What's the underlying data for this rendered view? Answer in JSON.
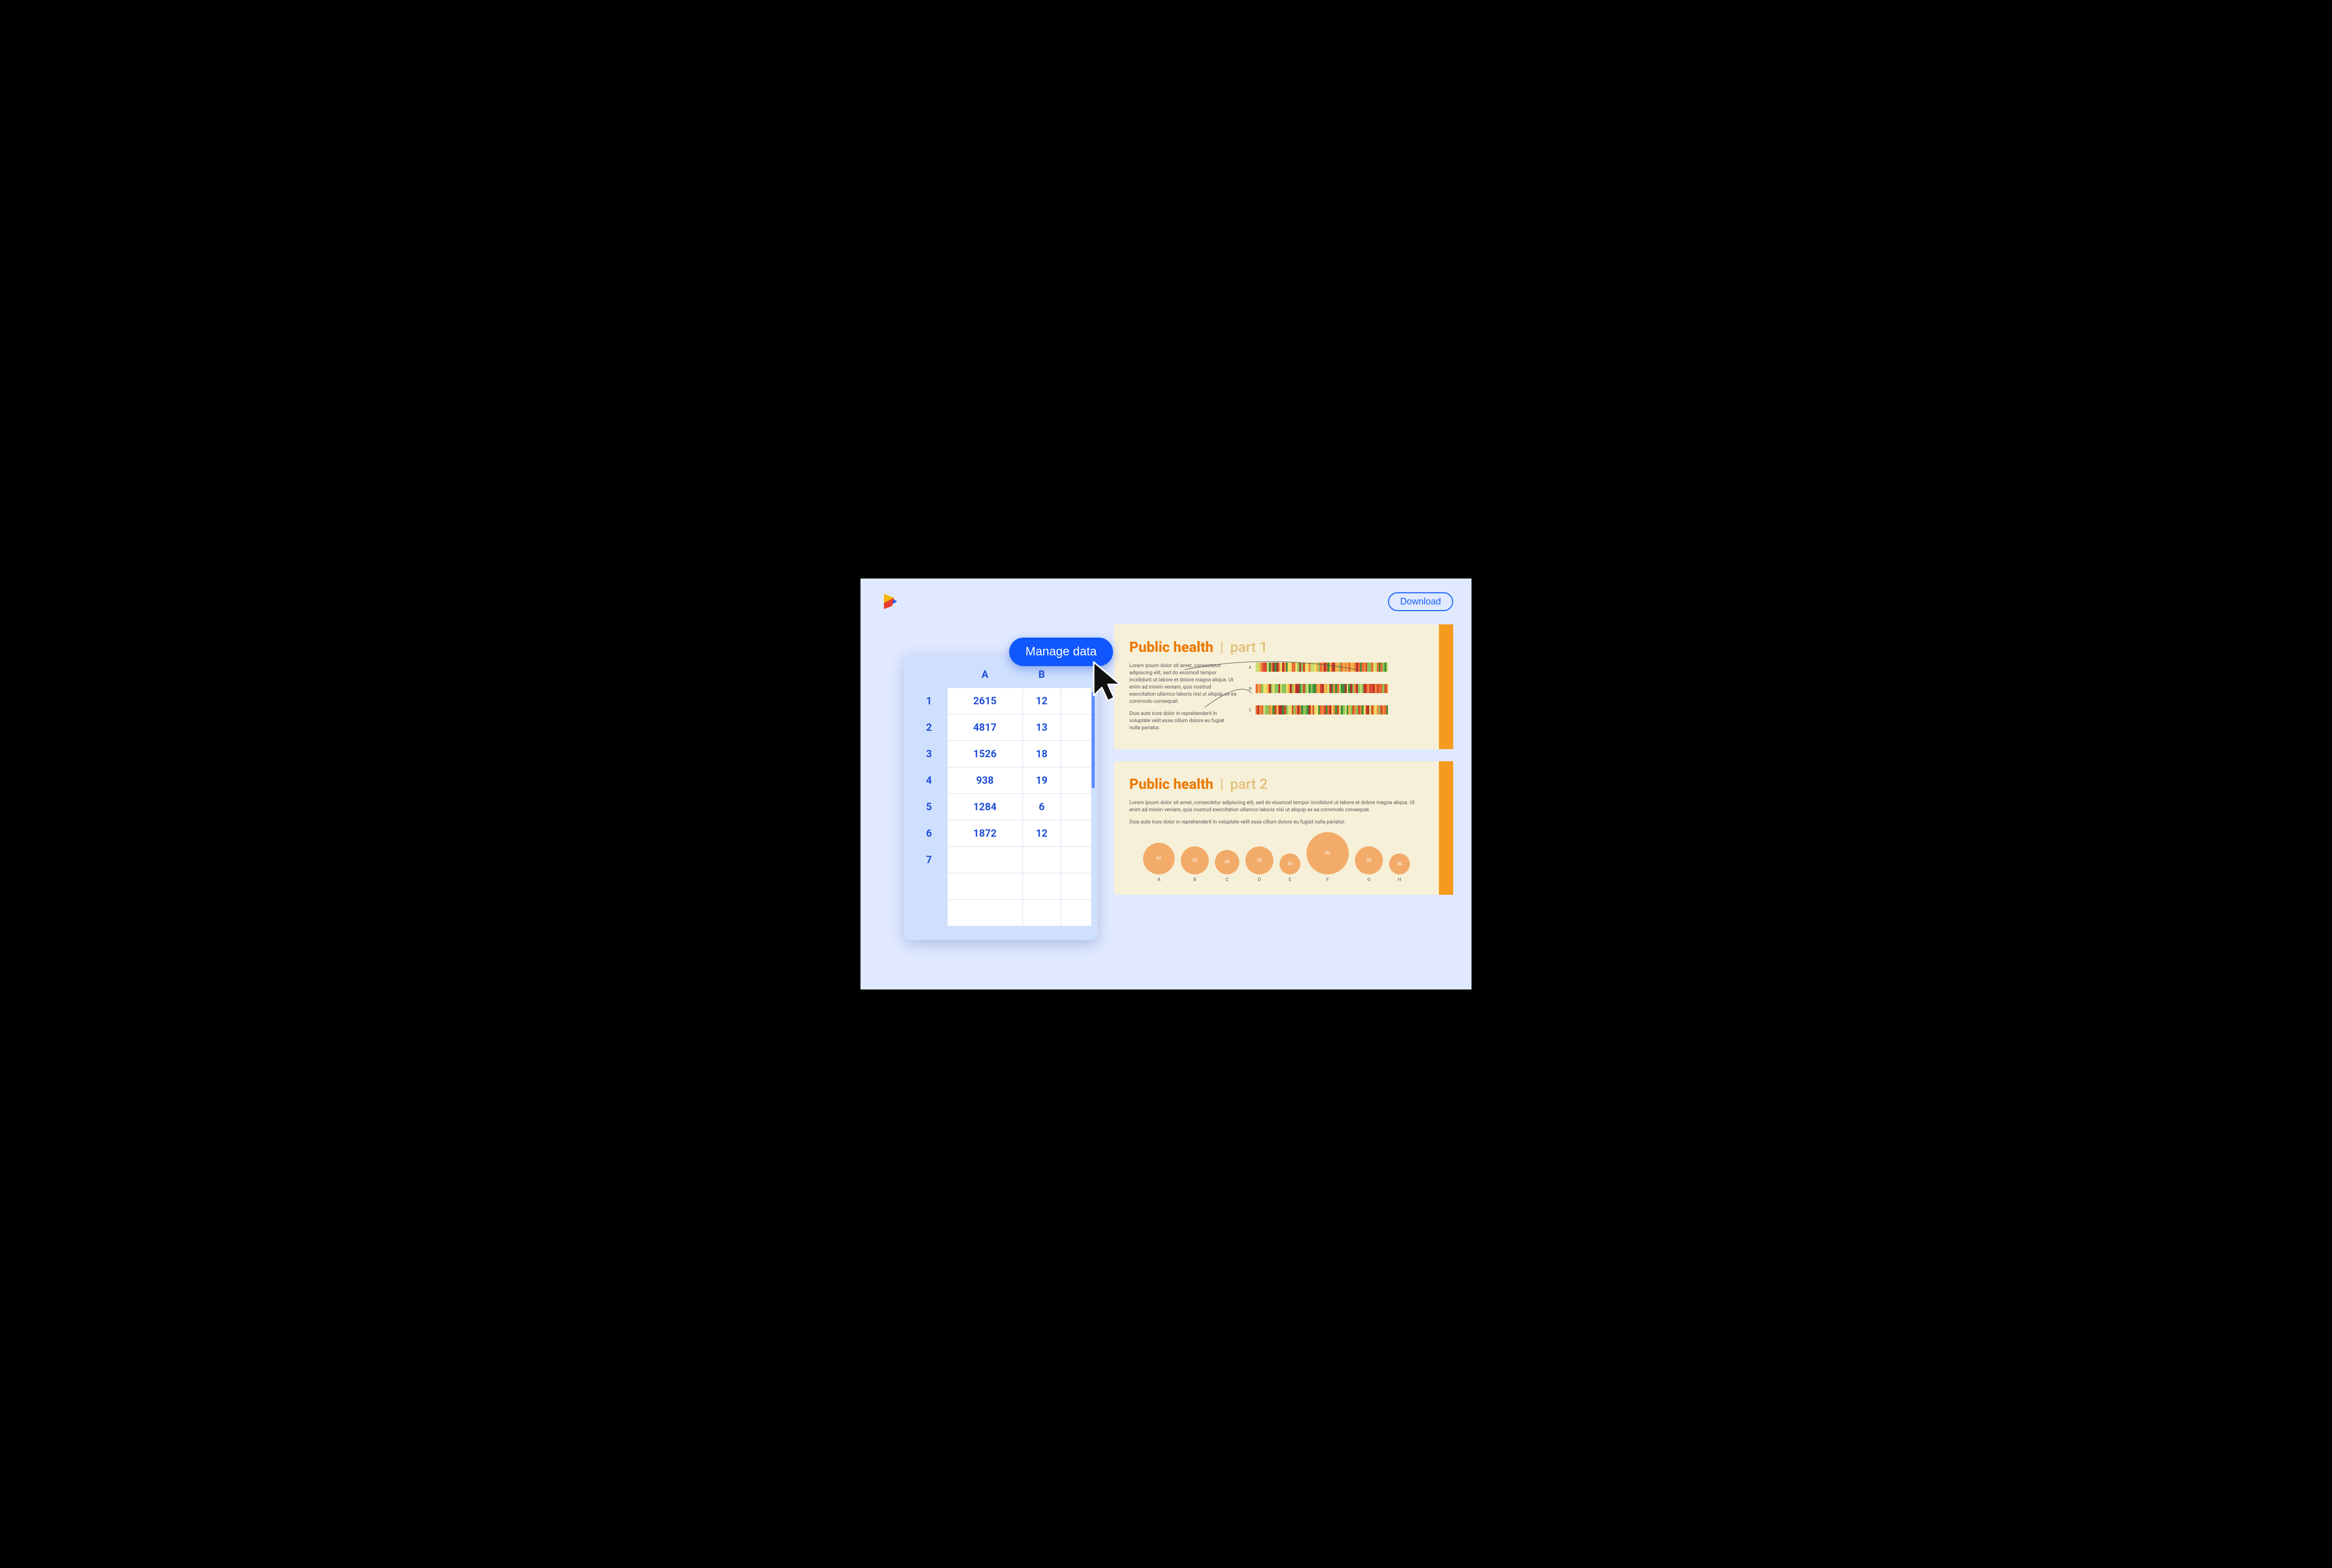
{
  "header": {
    "download_label": "Download"
  },
  "manage_button_label": "Manage data",
  "table": {
    "col_a": "A",
    "col_b": "B",
    "rows": [
      {
        "n": "1",
        "a": "2615",
        "b": "12"
      },
      {
        "n": "2",
        "a": "4817",
        "b": "13"
      },
      {
        "n": "3",
        "a": "1526",
        "b": "18"
      },
      {
        "n": "4",
        "a": "938",
        "b": "19"
      },
      {
        "n": "5",
        "a": "1284",
        "b": "6"
      },
      {
        "n": "6",
        "a": "1872",
        "b": "12"
      },
      {
        "n": "7",
        "a": "",
        "b": ""
      }
    ]
  },
  "panel1": {
    "title_main": "Public health",
    "title_sep": "|",
    "title_sub": "part 1",
    "para1": "Lorem ipsum dolor sit amet, consectetur adipiscing elit, sed do eiusmod tempor incididunt ut labore et dolore magna aliqua. Ut enim ad minim veniam, quis nostrud exercitation ullamco laboris nisi ut aliquip ex ea commodo consequat.",
    "para2": "Duis aute irure dolor in reprehenderit in voluptate velit esse cillum dolore eu fugiat nulla pariatur.",
    "barcode_labels": {
      "a": "A",
      "b": "B",
      "c": "C"
    }
  },
  "panel2": {
    "title_main": "Public health",
    "title_sep": "|",
    "title_sub": "part 2",
    "para1": "Lorem ipsum dolor sit amet, consectetur adipiscing elit, sed do eiusmod tempor incididunt ut labore et dolore magna aliqua. Ut enim ad minim veniam, quis nostrud exercitation ullamco laboris nisi ut aliquip ex ea commodo consequat.",
    "para2": "Duis aute irure dolor in reprehenderit in voluptate velit esse cillum dolore eu fugiat nulla pariatur."
  },
  "chart_data": {
    "type": "bubble",
    "categories": [
      "A",
      "B",
      "C",
      "D",
      "E",
      "F",
      "G",
      "H"
    ],
    "values": [
      60,
      50,
      40,
      50,
      30,
      90,
      50,
      30
    ],
    "title": "",
    "xlabel": "",
    "ylabel": ""
  }
}
